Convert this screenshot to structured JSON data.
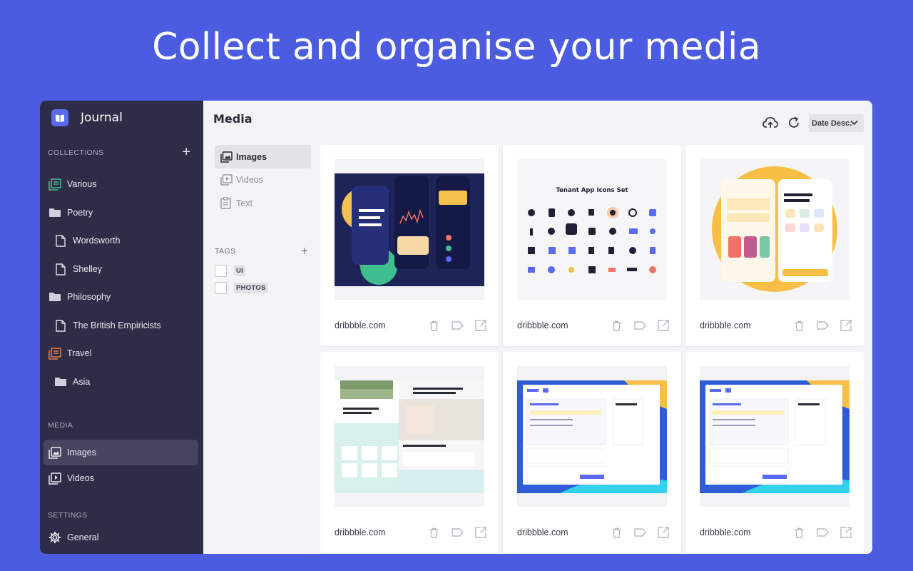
{
  "hero": {
    "title": "Collect and organise your media"
  },
  "app": {
    "name": "Journal"
  },
  "sidebar": {
    "collections_label": "COLLECTIONS",
    "collections": [
      {
        "label": "Various",
        "icon": "collection-icon",
        "color": "#3DBE8B"
      },
      {
        "label": "Poetry",
        "icon": "folder-icon"
      },
      {
        "label": "Wordsworth",
        "icon": "document-icon"
      },
      {
        "label": "Shelley",
        "icon": "document-icon"
      },
      {
        "label": "Philosophy",
        "icon": "folder-icon"
      },
      {
        "label": "The British Empiricists",
        "icon": "document-icon"
      },
      {
        "label": "Travel",
        "icon": "collection-icon",
        "color": "#F07A3A"
      },
      {
        "label": "Asia",
        "icon": "folder-icon"
      }
    ],
    "media_label": "MEDIA",
    "media": [
      {
        "label": "Images",
        "icon": "image-icon",
        "active": true
      },
      {
        "label": "Videos",
        "icon": "video-icon"
      }
    ],
    "settings_label": "SETTINGS",
    "settings": [
      {
        "label": "General",
        "icon": "gear-icon"
      }
    ]
  },
  "main": {
    "title": "Media",
    "sort": {
      "value": "Date Desc."
    },
    "types": [
      {
        "label": "Images",
        "icon": "image-icon",
        "active": true
      },
      {
        "label": "Videos",
        "icon": "video-icon"
      },
      {
        "label": "Text",
        "icon": "text-icon"
      }
    ],
    "tags_label": "TAGS",
    "tags": [
      {
        "label": "UI",
        "checked": false
      },
      {
        "label": "PHOTOS",
        "checked": false
      }
    ],
    "cards": [
      {
        "source": "dribbble.com",
        "thumb": "money-app"
      },
      {
        "source": "dribbble.com",
        "thumb": "icons-set",
        "thumb_caption": "Tenant App Icons Set"
      },
      {
        "source": "dribbble.com",
        "thumb": "meditation-app"
      },
      {
        "source": "dribbble.com",
        "thumb": "home-website"
      },
      {
        "source": "dribbble.com",
        "thumb": "dashboard-blue"
      },
      {
        "source": "dribbble.com",
        "thumb": "dashboard-blue"
      }
    ]
  },
  "colors": {
    "background": "#4B5CE0",
    "sidebar": "#2D2D47",
    "accent": "#5B6BF0"
  }
}
